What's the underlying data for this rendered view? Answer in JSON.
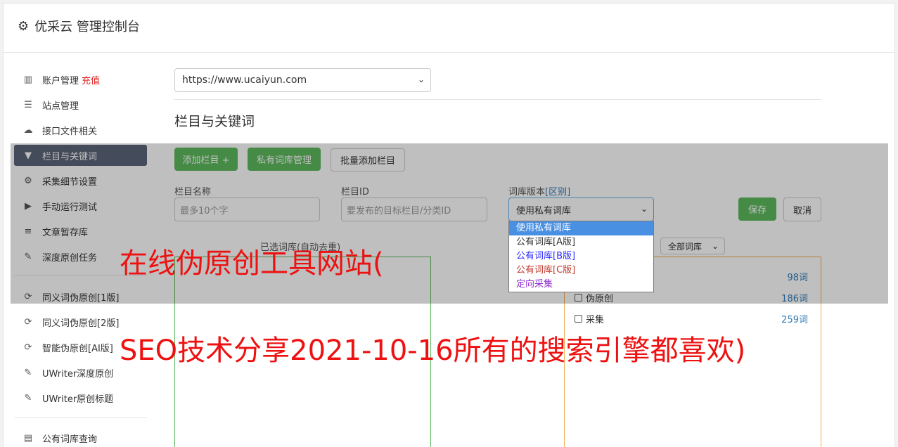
{
  "header": {
    "title": "优采云 管理控制台",
    "icon": "gear-icon"
  },
  "sidebar": {
    "items": [
      {
        "label": "账户管理",
        "badge": "充值",
        "icon": "bar-chart-icon"
      },
      {
        "label": "站点管理",
        "icon": "server-icon"
      },
      {
        "label": "接口文件相关",
        "icon": "cloud-upload-icon"
      },
      {
        "label": "栏目与关键词",
        "icon": "filter-icon",
        "active": true
      },
      {
        "label": "采集细节设置",
        "icon": "cogs-icon"
      },
      {
        "label": "手动运行测试",
        "icon": "play-circle-icon"
      },
      {
        "label": "文章暂存库",
        "icon": "database-icon"
      },
      {
        "label": "深度原创任务",
        "icon": "edit-icon"
      },
      {
        "label": "同义词伪原创[1版]",
        "icon": "refresh-icon"
      },
      {
        "label": "同义词伪原创[2版]",
        "icon": "refresh-icon"
      },
      {
        "label": "智能伪原创[AI版]",
        "icon": "refresh-icon"
      },
      {
        "label": "UWriter深度原创",
        "icon": "edit-icon"
      },
      {
        "label": "UWriter原创标题",
        "icon": "edit-icon"
      },
      {
        "label": "公有词库查询",
        "icon": "book-icon"
      }
    ]
  },
  "main": {
    "site_select": "https://www.ucaiyun.com",
    "section_title": "栏目与关键词",
    "buttons": {
      "add_column": "添加栏目 +",
      "private_lib": "私有词库管理",
      "batch_add": "批量添加栏目",
      "save": "保存",
      "cancel": "取消"
    },
    "fields": {
      "column_name_label": "栏目名称",
      "column_name_placeholder": "最多10个字",
      "column_id_label": "栏目ID",
      "column_id_placeholder": "要发布的目标栏目/分类ID",
      "lib_version_label": "词库版本",
      "lib_version_link": "[区别]",
      "lib_version_value": "使用私有词库"
    },
    "selected_lib_label": "已选词库(自动去重)",
    "all_lib_select": "全部词库",
    "lib_list": [
      {
        "label": "",
        "count": "98词"
      },
      {
        "label": "伪原创",
        "count": "186词"
      },
      {
        "label": "采集",
        "count": "259词"
      }
    ],
    "dropdown_options": [
      {
        "label": "使用私有词库",
        "color": "#ffffff"
      },
      {
        "label": "公有词库[A版]",
        "color": "#333333"
      },
      {
        "label": "公有词库[B版]",
        "color": "#2a2aff"
      },
      {
        "label": "公有词库[C版]",
        "color": "#c0392b"
      },
      {
        "label": "定向采集",
        "color": "#8e2bd0"
      }
    ]
  },
  "watermark": {
    "line1": "在线伪原创工具网站(",
    "line2": "SEO技术分享2021-10-16所有的搜索引擎都喜欢)"
  }
}
